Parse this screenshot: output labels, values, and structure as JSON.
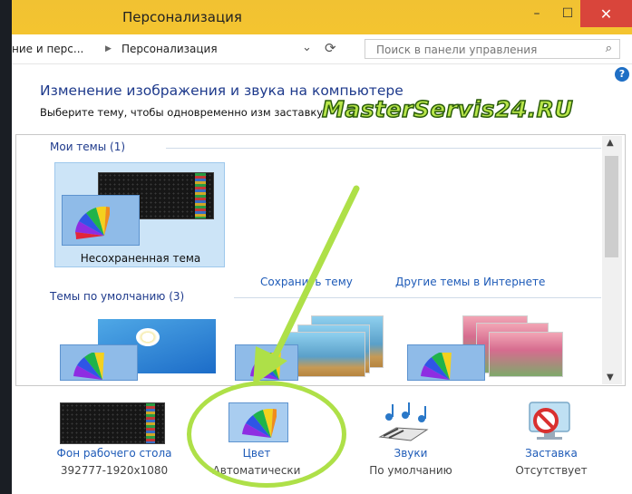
{
  "window": {
    "title": "Персонализация",
    "minimize_label": "–",
    "maximize_label": "☐",
    "close_label": "✕"
  },
  "address": {
    "crumb_parent": "ние и перс...",
    "crumb_sep": "▶",
    "crumb_current": "Персонализация",
    "dropdown_icon": "⌄",
    "refresh_icon": "⟳",
    "search_placeholder": "Поиск в панели управления",
    "search_icon": "⌕"
  },
  "help_label": "?",
  "heading": "Изменение изображения и звука на компьютере",
  "description": "Выберите тему, чтобы одновременно изм заставку.",
  "watermark": "MasterServis24.RU",
  "my_themes": {
    "header": "Мои темы (1)",
    "items": [
      {
        "name": "Несохраненная тема"
      }
    ]
  },
  "links": {
    "save_theme": "Сохранить тему",
    "online_themes": "Другие темы в Интернете"
  },
  "default_themes": {
    "header": "Темы по умолчанию (3)"
  },
  "scrollbar": {
    "up": "▲",
    "down": "▼"
  },
  "bottom": {
    "background": {
      "label": "Фон рабочего стола",
      "value": "392777-1920x1080"
    },
    "color": {
      "label": "Цвет",
      "value": "Автоматически"
    },
    "sounds": {
      "label": "Звуки",
      "value": "По умолчанию"
    },
    "screensaver": {
      "label": "Заставка",
      "value": "Отсутствует"
    }
  },
  "colors": {
    "titlebar": "#f4c430",
    "close": "#d9453b",
    "link": "#1e5bb8",
    "heading": "#1e3a8c",
    "annotation": "#aee048"
  }
}
